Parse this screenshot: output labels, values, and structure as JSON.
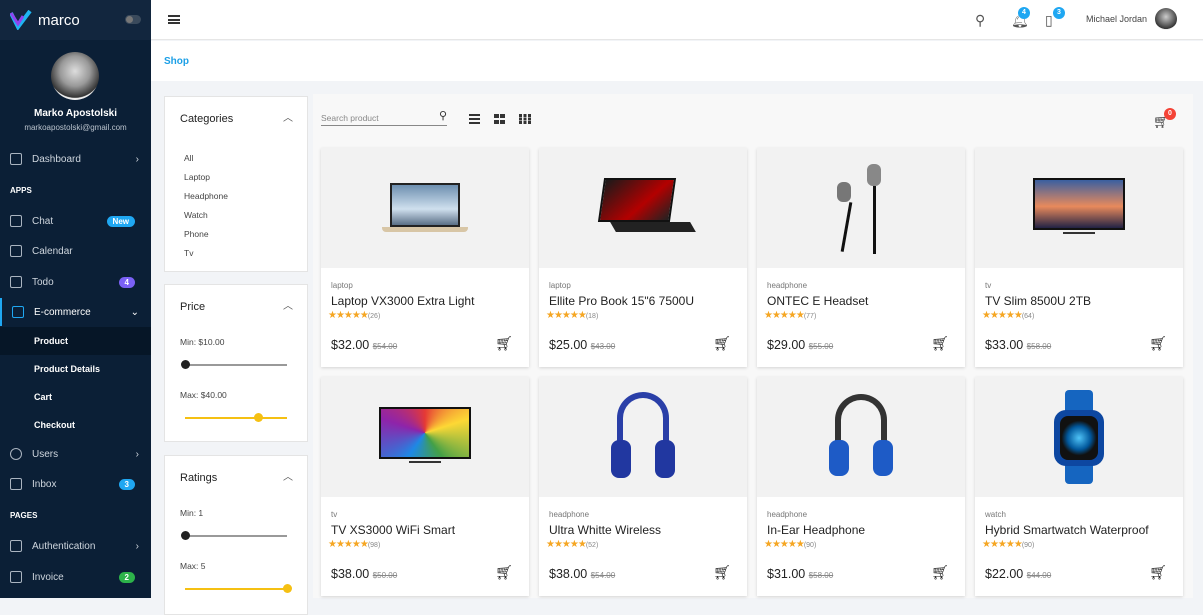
{
  "brand": {
    "name": "marco"
  },
  "profile": {
    "name": "Marko Apostolski",
    "email": "markoapostolski@gmail.com"
  },
  "nav": {
    "dashboard": "Dashboard",
    "apps": "APPS",
    "chat": "Chat",
    "chat_badge": "New",
    "calendar": "Calendar",
    "todo": "Todo",
    "todo_badge": "4",
    "ecommerce": "E-commerce",
    "product": "Product",
    "product_details": "Product Details",
    "cart": "Cart",
    "checkout": "Checkout",
    "users": "Users",
    "inbox": "Inbox",
    "inbox_badge": "3",
    "pages": "PAGES",
    "authentication": "Authentication",
    "invoice": "Invoice",
    "invoice_badge": "2"
  },
  "topbar": {
    "notif_count": "4",
    "msg_count": "3",
    "user": "Michael Jordan"
  },
  "breadcrumb": "Shop",
  "filters": {
    "categories_title": "Categories",
    "categories": [
      "All",
      "Laptop",
      "Headphone",
      "Watch",
      "Phone",
      "Tv"
    ],
    "price_title": "Price",
    "price_min": "Min: $10.00",
    "price_max": "Max: $40.00",
    "ratings_title": "Ratings",
    "rating_min": "Min: 1",
    "rating_max": "Max: 5"
  },
  "search": {
    "placeholder": "Search product"
  },
  "cart_count": "0",
  "colors": {
    "accent": "#1b9fe6",
    "star": "#f5a623",
    "sidebar": "#0b1f36",
    "slider": "#f5c013"
  },
  "products": [
    {
      "category": "laptop",
      "title": "Laptop VX3000 Extra Light",
      "stars": "★★★★★",
      "reviews": "(26)",
      "price": "$32.00",
      "old": "$54.00"
    },
    {
      "category": "laptop",
      "title": "Ellite Pro Book 15\"6 7500U",
      "stars": "★★★★★",
      "reviews": "(18)",
      "price": "$25.00",
      "old": "$43.00"
    },
    {
      "category": "headphone",
      "title": "ONTEC E Headset",
      "stars": "★★★★★",
      "reviews": "(77)",
      "price": "$29.00",
      "old": "$55.00"
    },
    {
      "category": "tv",
      "title": "TV Slim 8500U 2TB",
      "stars": "★★★★★",
      "reviews": "(64)",
      "price": "$33.00",
      "old": "$58.00"
    },
    {
      "category": "tv",
      "title": "TV XS3000 WiFi Smart",
      "stars": "★★★★★",
      "reviews": "(98)",
      "price": "$38.00",
      "old": "$50.00"
    },
    {
      "category": "headphone",
      "title": "Ultra Whitte Wireless",
      "stars": "★★★★★",
      "reviews": "(52)",
      "price": "$38.00",
      "old": "$54.00"
    },
    {
      "category": "headphone",
      "title": "In-Ear Headphone",
      "stars": "★★★★★",
      "reviews": "(90)",
      "price": "$31.00",
      "old": "$58.00"
    },
    {
      "category": "watch",
      "title": "Hybrid Smartwatch Waterproof",
      "stars": "★★★★★",
      "reviews": "(90)",
      "price": "$22.00",
      "old": "$44.00"
    }
  ]
}
